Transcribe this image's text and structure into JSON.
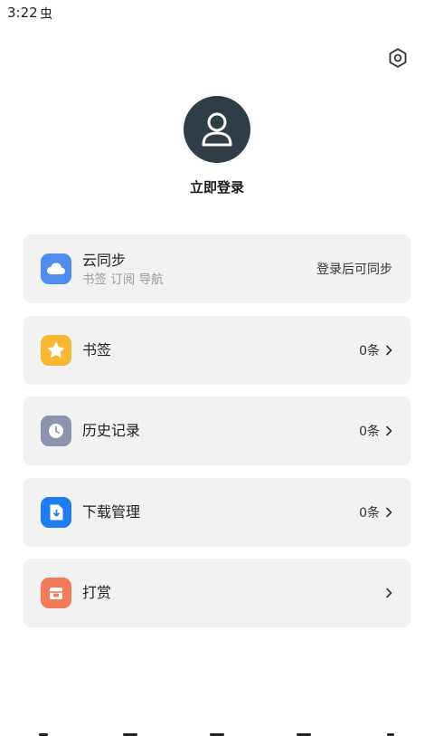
{
  "status_bar": {
    "time": "3:22",
    "indicator": "虫"
  },
  "header": {
    "settings_icon": "gear-icon"
  },
  "profile": {
    "avatar_icon": "user-icon",
    "login_label": "立即登录"
  },
  "menu": {
    "items": [
      {
        "id": "cloud-sync",
        "title": "云同步",
        "subtitle": "书签 订阅 导航",
        "right_text": "登录后可同步",
        "icon": "cloud-icon",
        "icon_color": "#4e8cf0",
        "has_chevron": false
      },
      {
        "id": "bookmarks",
        "title": "书签",
        "subtitle": "",
        "right_text": "0条",
        "icon": "star-icon",
        "icon_color": "#f7b731",
        "has_chevron": true
      },
      {
        "id": "history",
        "title": "历史记录",
        "subtitle": "",
        "right_text": "0条",
        "icon": "clock-icon",
        "icon_color": "#8a94ad",
        "has_chevron": true
      },
      {
        "id": "downloads",
        "title": "下载管理",
        "subtitle": "",
        "right_text": "0条",
        "icon": "download-icon",
        "icon_color": "#1e7ef0",
        "has_chevron": true
      },
      {
        "id": "reward",
        "title": "打赏",
        "subtitle": "",
        "right_text": "",
        "icon": "gift-icon",
        "icon_color": "#f27c5a",
        "has_chevron": true
      }
    ]
  },
  "bottom_nav": {
    "tabs": [
      "back-icon",
      "bookmark-nav-icon",
      "grid-icon",
      "tabs-icon",
      "profile-icon"
    ]
  }
}
